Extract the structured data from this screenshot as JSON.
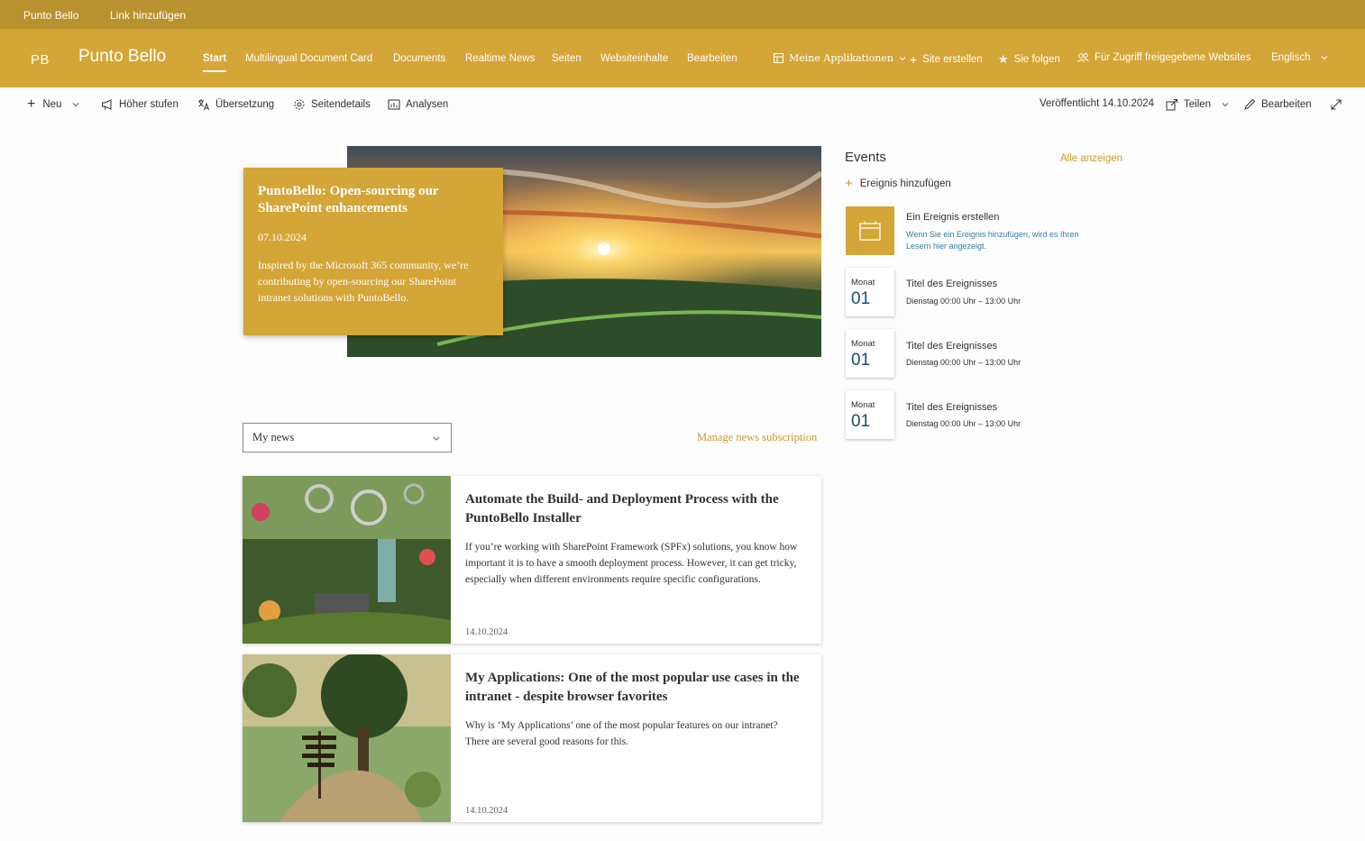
{
  "hubbar": {
    "site": "Punto Bello",
    "add_link": "Link hinzufügen"
  },
  "header": {
    "logo": "PB",
    "title": "Punto Bello",
    "nav": [
      "Start",
      "Multilingual Document Card",
      "Documents",
      "Realtime News",
      "Seiten",
      "Websiteinhalte",
      "Bearbeiten"
    ],
    "my_apps": "Meine Applikationen",
    "create_site": "Site erstellen",
    "follow": "Sie folgen",
    "shared_sites": "Für Zugriff freigegebene Websites",
    "language": "Englisch",
    "color": "#d4a537",
    "hub_color": "#b8922e"
  },
  "commandbar": {
    "new": "Neu",
    "promote": "Höher stufen",
    "translation": "Übersetzung",
    "page_details": "Seitendetails",
    "analytics": "Analysen",
    "published": "Veröffentlicht 14.10.2024",
    "share": "Teilen",
    "edit": "Bearbeiten"
  },
  "hero": {
    "title": "PuntoBello: Open-sourcing our SharePoint enhancements",
    "date": "07.10.2024",
    "text": "Inspired by the Microsoft 365 community, we’re contributing by open-sourcing our SharePoint intranet solutions with PuntoBello."
  },
  "events": {
    "title": "Events",
    "see_all": "Alle anzeigen",
    "add": "Ereignis hinzufügen",
    "create_title": "Ein Ereignis erstellen",
    "create_desc": "Wenn Sie ein Ereignis hinzufügen, wird es Ihren Lesern hier angezeigt.",
    "items": [
      {
        "month": "Monat",
        "day": "01",
        "name": "Titel des Ereignisses",
        "time": "Dienstag 00:00 Uhr – 13:00 Uhr"
      },
      {
        "month": "Monat",
        "day": "01",
        "name": "Titel des Ereignisses",
        "time": "Dienstag 00:00 Uhr – 13:00 Uhr"
      },
      {
        "month": "Monat",
        "day": "01",
        "name": "Titel des Ereignisses",
        "time": "Dienstag 00:00 Uhr – 13:00 Uhr"
      }
    ]
  },
  "news": {
    "filter": "My news",
    "manage": "Manage news subscription",
    "items": [
      {
        "title": "Automate the Build- and Deployment Process with the PuntoBello Installer",
        "text": "If you’re working with SharePoint Framework (SPFx) solutions, you know how important it is to have a smooth deployment process. However, it can get tricky, especially when different environments require specific configurations.",
        "date": "14.10.2024"
      },
      {
        "title": "My Applications: One of the most popular use cases in the intranet - despite browser favorites",
        "text": "Why is ‘My Applications’ one of the most popular features on our intranet? There are several good reasons for this.",
        "date": "14.10.2024"
      }
    ]
  }
}
